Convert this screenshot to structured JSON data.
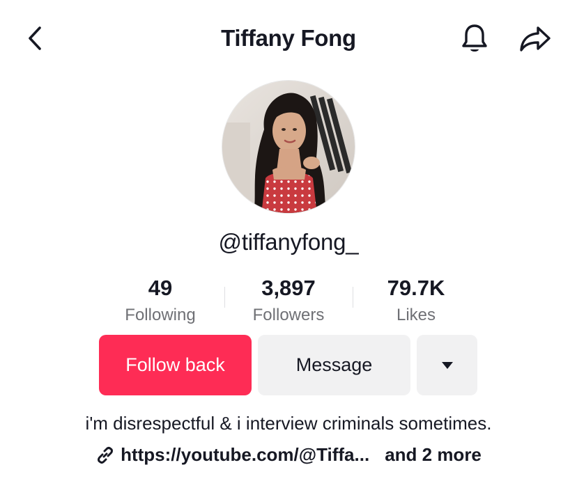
{
  "header": {
    "title": "Tiffany Fong",
    "back_icon": "chevron-left-icon",
    "bell_icon": "bell-icon",
    "share_icon": "share-arrow-icon"
  },
  "profile": {
    "username": "@tiffanyfong_",
    "avatar_alt": "profile photo"
  },
  "stats": [
    {
      "value": "49",
      "label": "Following"
    },
    {
      "value": "3,897",
      "label": "Followers"
    },
    {
      "value": "79.7K",
      "label": "Likes"
    }
  ],
  "actions": {
    "follow_label": "Follow back",
    "message_label": "Message",
    "more_icon": "caret-down-icon"
  },
  "bio": {
    "text": "i'm disrespectful & i interview criminals sometimes.",
    "link_text": "https://youtube.com/@Tiffa...",
    "more_links": "and 2 more",
    "link_icon": "link-icon"
  },
  "colors": {
    "accent": "#fe2c55",
    "secondary_button": "#f1f1f2",
    "text": "#161823",
    "muted": "#6f7075"
  }
}
